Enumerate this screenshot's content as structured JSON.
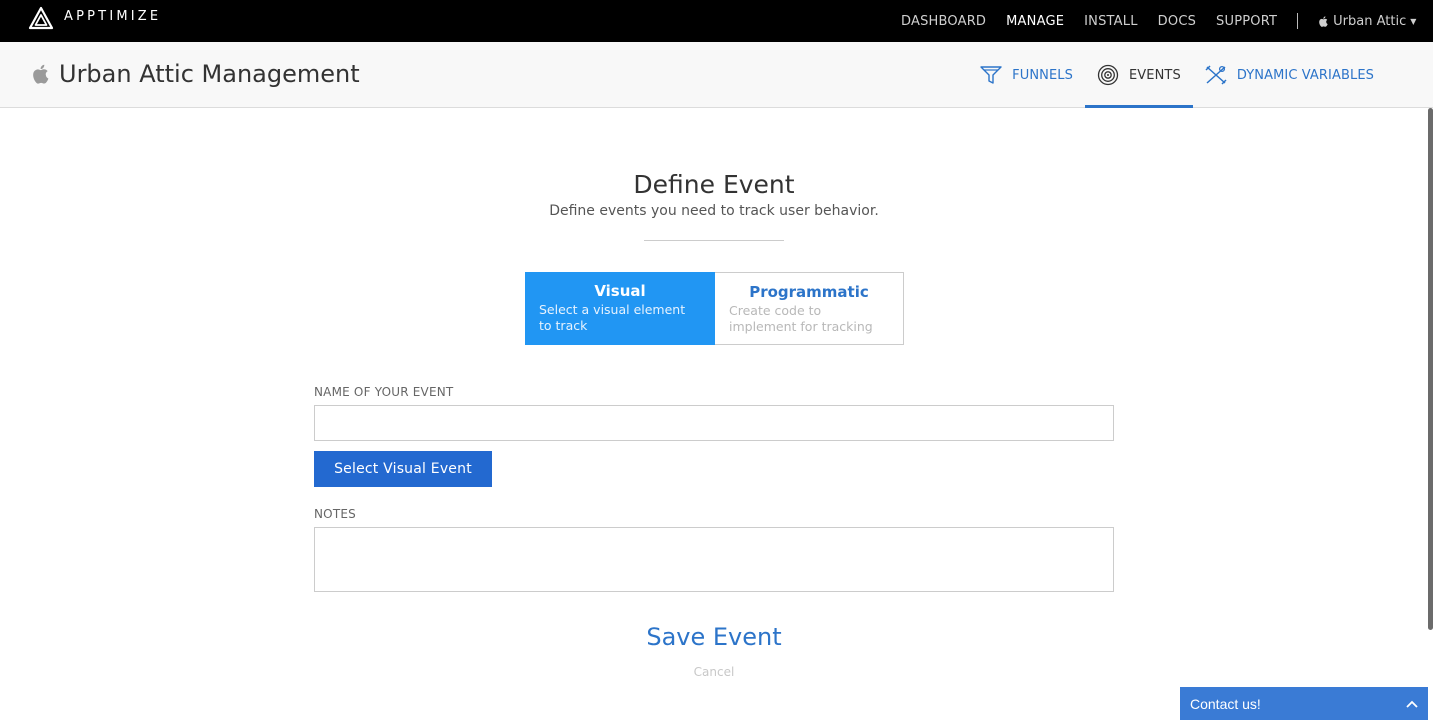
{
  "brand": {
    "name": "APPTIMIZE"
  },
  "topnav": {
    "items": [
      "DASHBOARD",
      "MANAGE",
      "INSTALL",
      "DOCS",
      "SUPPORT"
    ],
    "active": "MANAGE",
    "account": "Urban Attic"
  },
  "header": {
    "app_title": "Urban Attic Management",
    "tabs": [
      {
        "label": "FUNNELS",
        "icon": "funnel-icon"
      },
      {
        "label": "EVENTS",
        "icon": "target-icon",
        "active": true
      },
      {
        "label": "DYNAMIC VARIABLES",
        "icon": "variables-icon"
      }
    ]
  },
  "main": {
    "title": "Define Event",
    "subtitle": "Define events you need to track user behavior.",
    "types": [
      {
        "title": "Visual",
        "desc": "Select a visual element to track",
        "selected": true
      },
      {
        "title": "Programmatic",
        "desc": "Create code to implement for tracking",
        "selected": false
      }
    ],
    "name_label": "NAME OF YOUR EVENT",
    "name_value": "",
    "select_button": "Select Visual Event",
    "notes_label": "NOTES",
    "notes_value": "",
    "save": "Save Event",
    "cancel": "Cancel"
  },
  "contact": {
    "label": "Contact us!"
  },
  "colors": {
    "accent": "#2c74c9",
    "selected": "#2196f3",
    "button": "#2369d0",
    "topbar": "#000000"
  }
}
